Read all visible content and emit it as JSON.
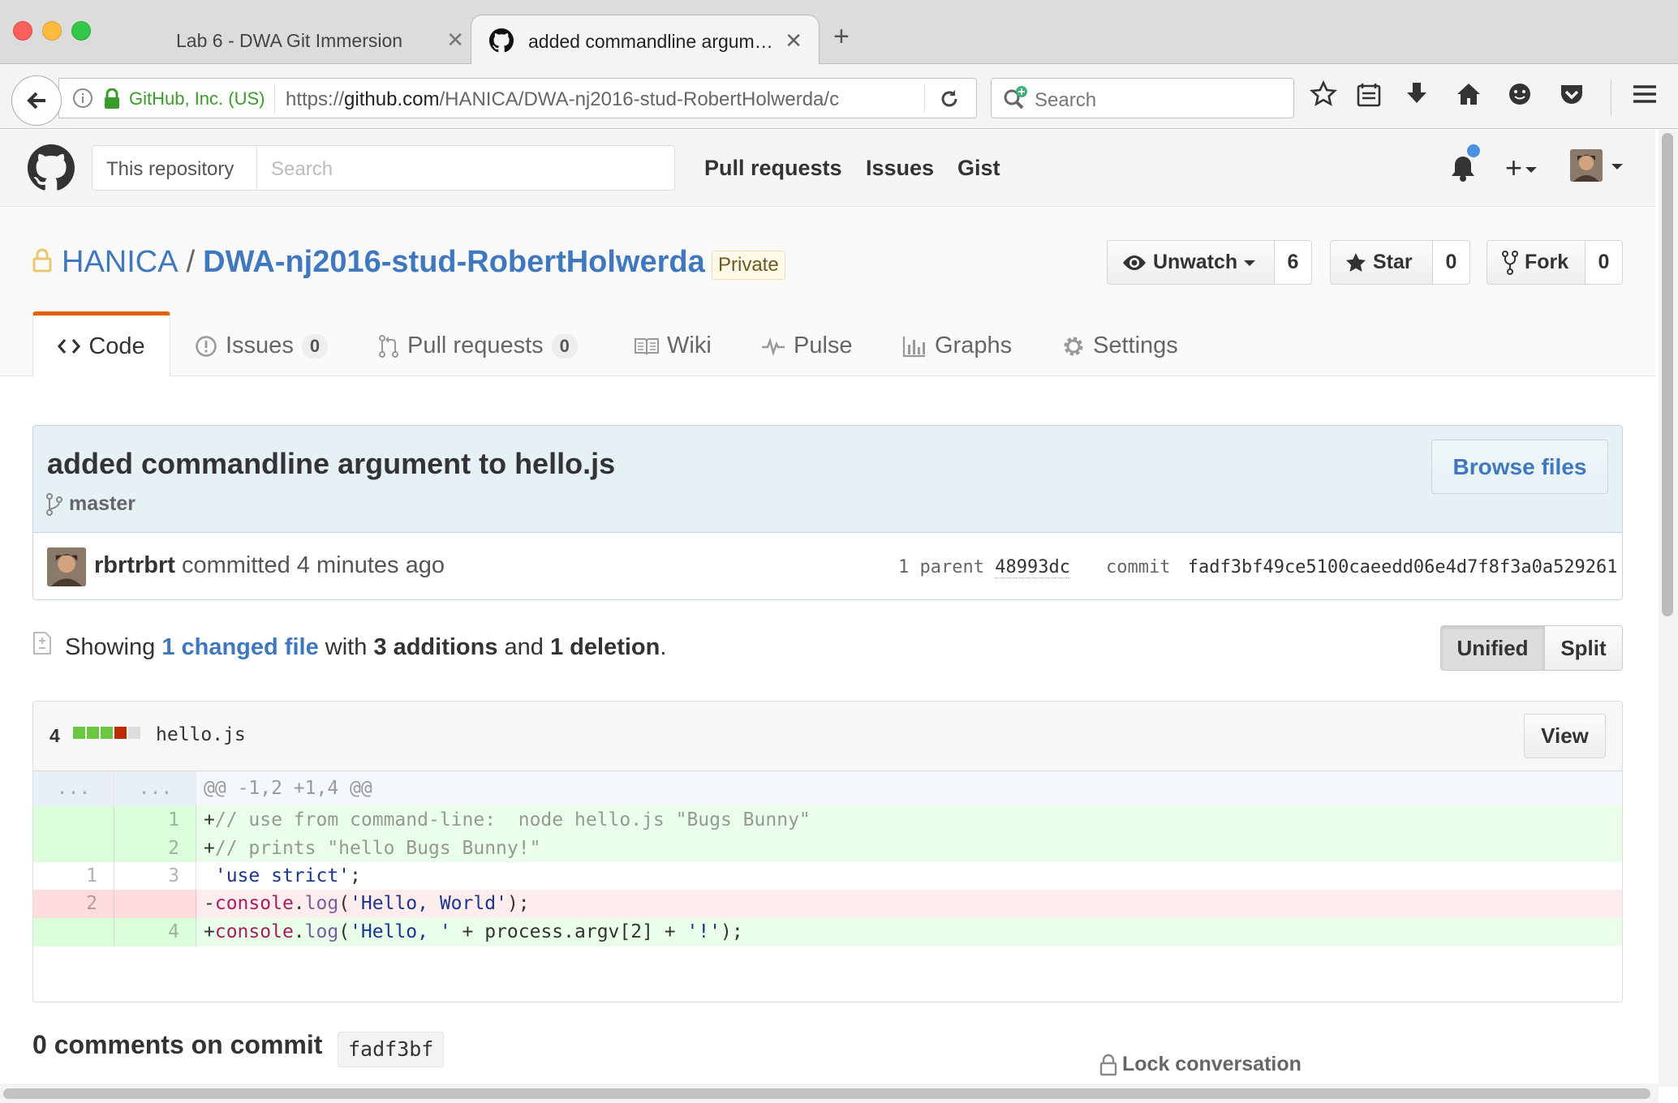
{
  "browser": {
    "tabs": [
      {
        "title": "Lab 6 - DWA Git Immersion",
        "active": false
      },
      {
        "title": "added commandline argum…",
        "active": true
      }
    ],
    "identity": "GitHub, Inc. (US)",
    "url_prefix": "https://",
    "url_host": "github.com",
    "url_path": "/HANICA/DWA-nj2016-stud-RobertHolwerda/c",
    "search_placeholder": "Search"
  },
  "github": {
    "search_scope": "This repository",
    "search_placeholder": "Search",
    "nav": [
      "Pull requests",
      "Issues",
      "Gist"
    ]
  },
  "repo": {
    "owner": "HANICA",
    "separator": "/",
    "name": "DWA-nj2016-stud-RobertHolwerda",
    "visibility": "Private",
    "watch_label": "Unwatch",
    "watch_count": "6",
    "star_label": "Star",
    "star_count": "0",
    "fork_label": "Fork",
    "fork_count": "0",
    "tabs": [
      {
        "label": "Code"
      },
      {
        "label": "Issues",
        "count": "0"
      },
      {
        "label": "Pull requests",
        "count": "0"
      },
      {
        "label": "Wiki"
      },
      {
        "label": "Pulse"
      },
      {
        "label": "Graphs"
      },
      {
        "label": "Settings"
      }
    ]
  },
  "commit": {
    "title": "added commandline argument to hello.js",
    "branch": "master",
    "browse_label": "Browse files",
    "author": "rbrtrbrt",
    "action": "committed",
    "time": "4 minutes ago",
    "parent_label": "1 parent",
    "parent_sha": "48993dc",
    "commit_label": "commit",
    "sha": "fadf3bf49ce5100caeedd06e4d7f8f3a0a529261"
  },
  "toc": {
    "showing": "Showing",
    "changed": "1 changed file",
    "with": "with",
    "additions": "3 additions",
    "and": "and",
    "deletions": "1 deletion",
    "period": ".",
    "unified_label": "Unified",
    "split_label": "Split"
  },
  "file": {
    "changes": "4",
    "name": "hello.js",
    "view_label": "View",
    "hunk_ellipsis": "...",
    "hunk_header": "@@ -1,2 +1,4 @@",
    "lines": [
      {
        "old": "",
        "new": "1",
        "type": "add",
        "text": "+// use from command-line:  node hello.js \"Bugs Bunny\""
      },
      {
        "old": "",
        "new": "2",
        "type": "add",
        "text": "+// prints \"hello Bugs Bunny!\""
      },
      {
        "old": "1",
        "new": "3",
        "type": "context",
        "text": " 'use strict';"
      },
      {
        "old": "2",
        "new": "",
        "type": "del",
        "text": "-console.log('Hello, World');"
      },
      {
        "old": "",
        "new": "4",
        "type": "add",
        "text": "+console.log('Hello, ' + process.argv[2] + '!');"
      }
    ]
  },
  "comments": {
    "title": "0 comments on commit",
    "sha": "fadf3bf",
    "lock_label": "Lock conversation"
  },
  "colors": {
    "link": "#4078c0",
    "addition": "#6cc644",
    "deletion": "#bd2c00",
    "accent_tab": "#e36209"
  }
}
